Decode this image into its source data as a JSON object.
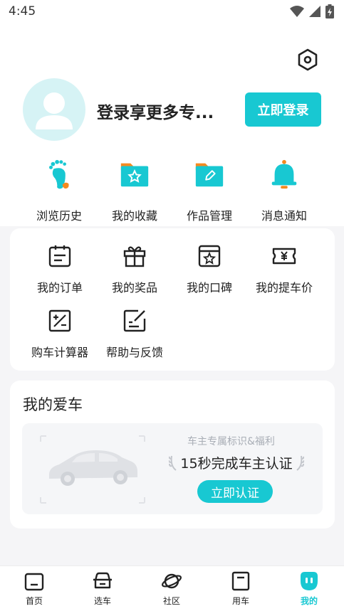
{
  "status_bar": {
    "time": "4:45"
  },
  "profile": {
    "login_prompt": "登录享更多专...",
    "login_button": "立即登录"
  },
  "quick_links": [
    {
      "label": "浏览历史",
      "icon": "footprint-icon"
    },
    {
      "label": "我的收藏",
      "icon": "folder-star-icon"
    },
    {
      "label": "作品管理",
      "icon": "folder-edit-icon"
    },
    {
      "label": "消息通知",
      "icon": "bell-icon"
    }
  ],
  "tools": [
    {
      "label": "我的订单",
      "icon": "order-icon"
    },
    {
      "label": "我的奖品",
      "icon": "gift-icon"
    },
    {
      "label": "我的口碑",
      "icon": "review-icon"
    },
    {
      "label": "我的提车价",
      "icon": "price-ticket-icon"
    },
    {
      "label": "购车计算器",
      "icon": "calculator-icon"
    },
    {
      "label": "帮助与反馈",
      "icon": "feedback-icon"
    }
  ],
  "my_car": {
    "title": "我的爱车",
    "subtitle": "车主专属标识&福利",
    "headline": "15秒完成车主认证",
    "verify_button": "立即认证"
  },
  "tabs": [
    {
      "label": "首页",
      "icon": "home-icon"
    },
    {
      "label": "选车",
      "icon": "car-front-icon"
    },
    {
      "label": "社区",
      "icon": "planet-icon"
    },
    {
      "label": "用车",
      "icon": "box-icon"
    },
    {
      "label": "我的",
      "icon": "me-icon",
      "active": true
    }
  ],
  "colors": {
    "accent": "#18c8d2",
    "orange": "#f58a1f",
    "background": "#f5f5f7"
  }
}
